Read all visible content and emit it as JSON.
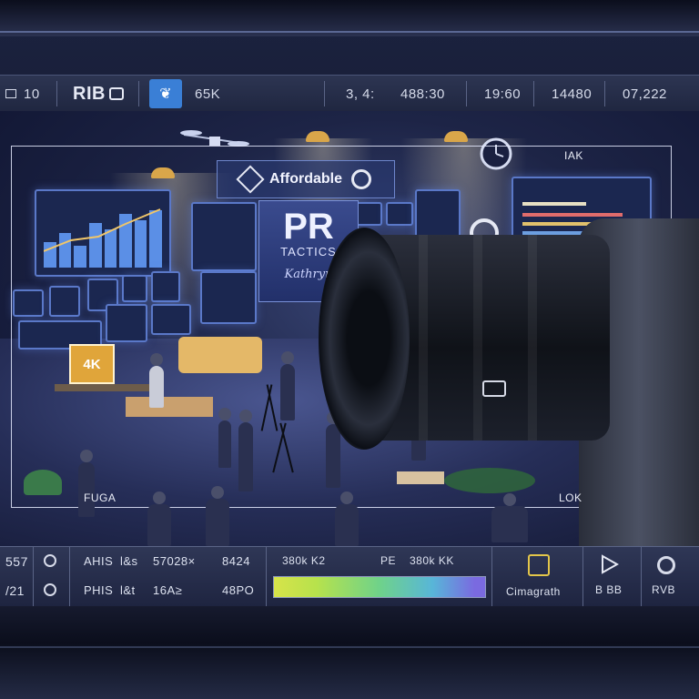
{
  "topbar": {
    "item1_label": "10",
    "logo": "RIB",
    "mode_value": "65K",
    "field_a": "3, 4:",
    "field_b": "488:30",
    "field_c": "19:60",
    "field_d": "14480",
    "field_e": "07,222"
  },
  "scene": {
    "affordable": "Affordable",
    "pr_title": "PR",
    "pr_subtitle": "TACTICS",
    "signature": "Kathryn",
    "panel_label": "IAK",
    "corner_label": "LOK",
    "floor_label": "FUGA",
    "monitor_label": "4K"
  },
  "bottom": {
    "row1_left": "557",
    "row2_left": "/21",
    "row1_a": "AHIS",
    "row1_b": "l&s",
    "row1_c": "57028×",
    "row1_d": "8424",
    "row2_a": "PHIS",
    "row2_b": "l&t",
    "row2_c": "16A≥",
    "row2_d": "48PO",
    "meter_left": "380k K2",
    "meter_mid": "PE",
    "meter_right": "380k KK",
    "brand": "Cimagrath",
    "play_label": "B BB",
    "rec_label": "RVB"
  },
  "colors": {
    "accent": "#3a7fd6",
    "lamp": "#d9a64a",
    "panel_border": "#5a78c8"
  }
}
